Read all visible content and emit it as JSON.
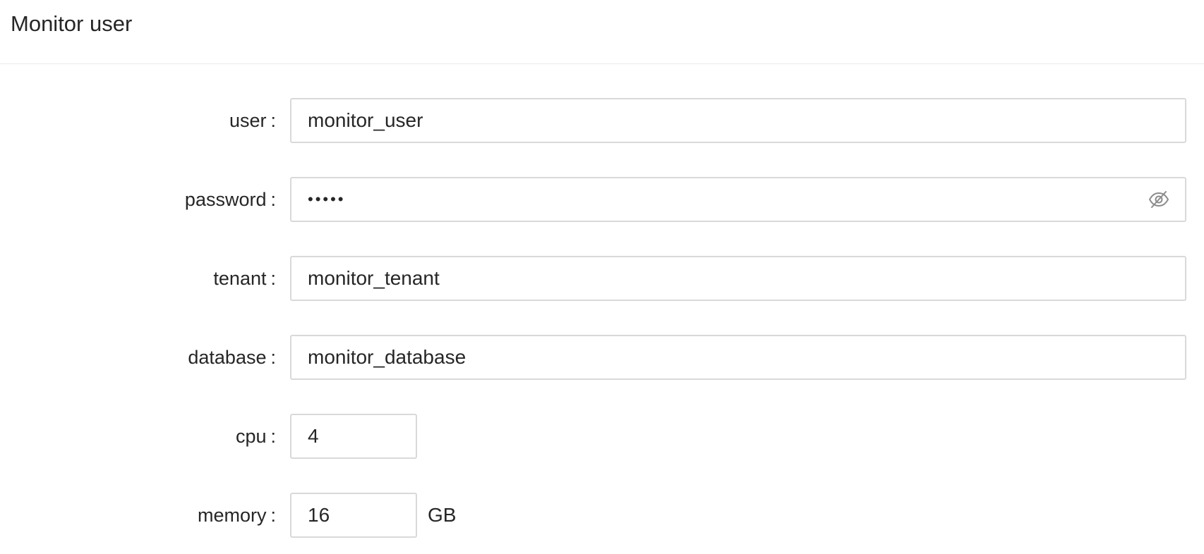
{
  "header": {
    "title": "Monitor user"
  },
  "form": {
    "user": {
      "label": "user",
      "value": "monitor_user"
    },
    "password": {
      "label": "password",
      "value": "•••••",
      "toggle_icon": "eye-slash-icon"
    },
    "tenant": {
      "label": "tenant",
      "value": "monitor_tenant"
    },
    "database": {
      "label": "database",
      "value": "monitor_database"
    },
    "cpu": {
      "label": "cpu",
      "value": "4"
    },
    "memory": {
      "label": "memory",
      "value": "16",
      "unit": "GB"
    },
    "colon": ":"
  },
  "colors": {
    "border": "#d9d9d9",
    "text": "#262626",
    "divider": "#ebebeb"
  }
}
